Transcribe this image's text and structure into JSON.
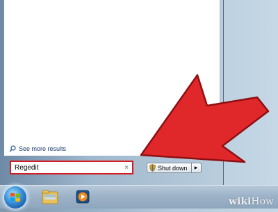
{
  "start_menu": {
    "see_more_label": "See more results",
    "search": {
      "value": "Regedit",
      "clear_icon": "×"
    },
    "shutdown": {
      "label": "Shut down",
      "arrow_icon": "▶"
    }
  },
  "taskbar": {
    "start_icon": "windows-start-orb",
    "pinned": [
      "windows-explorer-icon",
      "media-player-icon"
    ]
  },
  "annotation": {
    "color": "#e0282b",
    "shape": "arrow-pointing-to-search-box"
  },
  "watermark": {
    "part1": "wiki",
    "part2": "How"
  },
  "colors": {
    "search_highlight": "#d21b22",
    "arrow": "#e0282b"
  }
}
